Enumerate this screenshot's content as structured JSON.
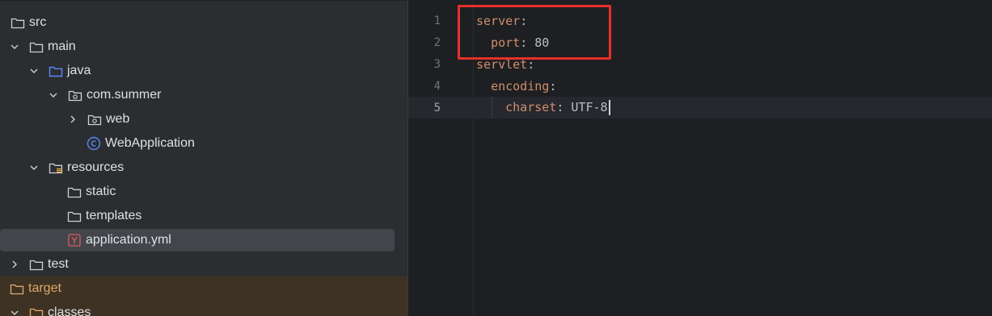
{
  "project_tree": {
    "items": [
      {
        "label": "src",
        "expanded": true,
        "icon": "folder-icon"
      },
      {
        "label": "main",
        "expanded": true,
        "icon": "folder-icon"
      },
      {
        "label": "java",
        "expanded": true,
        "icon": "source-folder-icon"
      },
      {
        "label": "com.summer",
        "expanded": true,
        "icon": "package-icon"
      },
      {
        "label": "web",
        "expanded": false,
        "icon": "package-icon"
      },
      {
        "label": "WebApplication",
        "icon": "class-icon"
      },
      {
        "label": "resources",
        "expanded": true,
        "icon": "resources-folder-icon"
      },
      {
        "label": "static",
        "icon": "folder-icon"
      },
      {
        "label": "templates",
        "icon": "folder-icon"
      },
      {
        "label": "application.yml",
        "icon": "yaml-file-icon",
        "selected": true
      },
      {
        "label": "test",
        "expanded": false,
        "icon": "folder-icon"
      },
      {
        "label": "target",
        "expanded": true,
        "icon": "excluded-folder-icon"
      },
      {
        "label": "classes",
        "expanded": true,
        "icon": "excluded-folder-icon"
      }
    ]
  },
  "editor": {
    "file": "application.yml",
    "current_line": 5,
    "lines": [
      {
        "number": "1",
        "key": "server",
        "sep": ":",
        "value": ""
      },
      {
        "number": "2",
        "key": "port",
        "sep": ": ",
        "value": "80"
      },
      {
        "number": "3",
        "key": "servlet",
        "sep": ":",
        "value": ""
      },
      {
        "number": "4",
        "key": "encoding",
        "sep": ":",
        "value": ""
      },
      {
        "number": "5",
        "key": "charset",
        "sep": ": ",
        "value": "UTF-8"
      }
    ]
  },
  "colors": {
    "annotation": "#e5302a",
    "yaml_key": "#cf8e6d",
    "yaml_number": "#2aacb8",
    "tree_bg": "#2b2d30",
    "editor_bg": "#1e1f22"
  }
}
